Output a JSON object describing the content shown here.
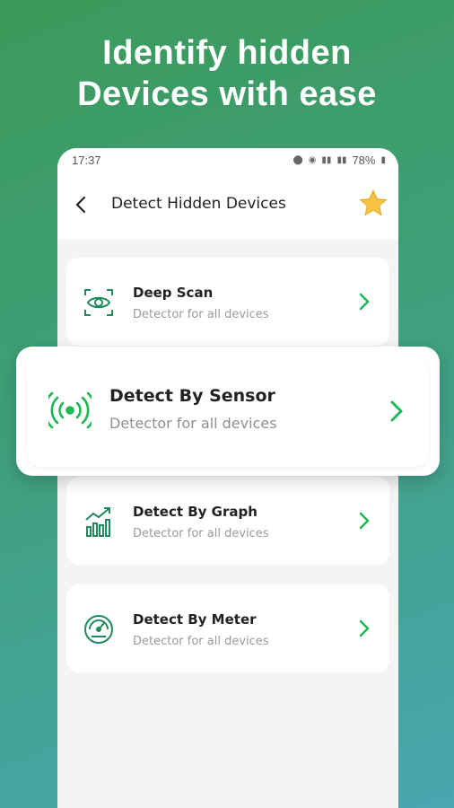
{
  "headline": {
    "line1": "Identify hidden",
    "line2": "Devices with ease"
  },
  "status_bar": {
    "time": "17:37",
    "battery": "78%"
  },
  "app_bar": {
    "title": "Detect Hidden Devices"
  },
  "items": [
    {
      "title": "Deep Scan",
      "subtitle": "Detector for all devices",
      "icon": "eye-scan-icon"
    },
    {
      "title": "Detect By Sensor",
      "subtitle": "Detector for all devices",
      "icon": "sensor-waves-icon"
    },
    {
      "title": "Detect By Graph",
      "subtitle": "Detector for all devices",
      "icon": "graph-icon"
    },
    {
      "title": "Detect By Meter",
      "subtitle": "Detector for all devices",
      "icon": "meter-icon"
    }
  ],
  "colors": {
    "accent_green": "#1db954",
    "star": "#f6c343"
  }
}
